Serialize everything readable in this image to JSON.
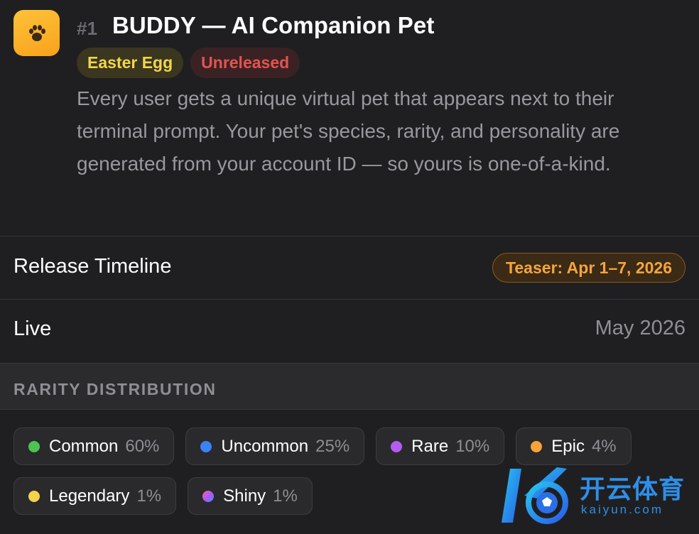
{
  "feature": {
    "rank": "#1",
    "title": "BUDDY — AI Companion Pet",
    "icon": "paw-icon",
    "badges": [
      {
        "label": "Easter Egg",
        "color": "#f1d64a"
      },
      {
        "label": "Unreleased",
        "color": "#e4534f"
      }
    ],
    "description": "Every user gets a unique virtual pet that appears next to their terminal prompt. Your pet's species, rarity, and personality are generated from your account ID — so yours is one-of-a-kind."
  },
  "timeline": {
    "label": "Release Timeline",
    "teaser": "Teaser: Apr 1–7, 2026",
    "live_label": "Live",
    "live_value": "May 2026"
  },
  "rarity": {
    "title": "RARITY DISTRIBUTION",
    "items": [
      {
        "name": "Common",
        "pct": "60%",
        "color": "#4cc451"
      },
      {
        "name": "Uncommon",
        "pct": "25%",
        "color": "#3b82f6"
      },
      {
        "name": "Rare",
        "pct": "10%",
        "color": "#b45cf0"
      },
      {
        "name": "Epic",
        "pct": "4%",
        "color": "#f5a43a"
      },
      {
        "name": "Legendary",
        "pct": "1%",
        "color": "#f2d34a"
      },
      {
        "name": "Shiny",
        "pct": "1%",
        "color": "gradient"
      }
    ]
  },
  "watermark": {
    "text_cn": "开云体育",
    "text_en": "kaiyun.com"
  }
}
